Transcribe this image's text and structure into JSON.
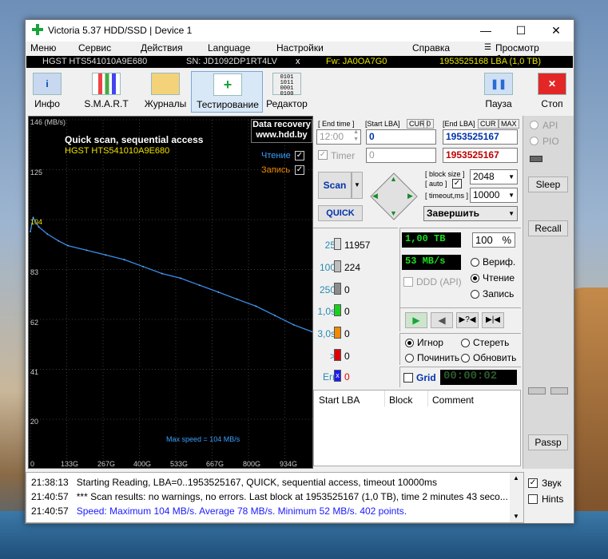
{
  "window": {
    "title": "Victoria 5.37 HDD/SSD | Device 1",
    "minimize": "—",
    "maximize": "☐",
    "close": "✕"
  },
  "menu": [
    "Меню",
    "Сервис",
    "Действия",
    "Language",
    "Настройки",
    "Справка"
  ],
  "menu_right": "Просмотр буфера",
  "info": {
    "model": "HGST HTS541010A9E680",
    "serial": "SN: JD1092DP1RT4LV",
    "x": "x",
    "fw": "Fw: JA0OA7G0",
    "capacity": "1953525168 LBA (1,0 TB)"
  },
  "toolbar": {
    "info": "Инфо",
    "smart": "S.M.A.R.T",
    "logs": "Журналы",
    "test": "Тестирование",
    "editor": "Редактор",
    "pause": "Пауза",
    "stop": "Стоп"
  },
  "graph": {
    "ymax": "146 (MB/s)",
    "y125": "125",
    "y104": "104",
    "y83": "83",
    "y62": "62",
    "y41": "41",
    "y20": "20",
    "x0": "0",
    "x1": "133G",
    "x2": "267G",
    "x3": "400G",
    "x4": "533G",
    "x5": "667G",
    "x6": "800G",
    "x7": "934G",
    "caption1": "Quick scan, sequential access",
    "caption2": "HGST HTS541010A9E680",
    "recovery1": "Data recovery",
    "recovery2": "www.hdd.by",
    "read_label": "Чтение",
    "write_label": "Запись",
    "max_speed": "Max speed = 104 MB/s"
  },
  "controls": {
    "end_time_label": "[ End time ]",
    "start_lba_label": "[Start LBA]",
    "cur": "CUR",
    "zero": "0",
    "end_lba_label": "[End LBA]",
    "max": "MAX",
    "time_value": "12:00",
    "start_lba": "0",
    "end_lba": "1953525167",
    "end_lba2": "1953525167",
    "timer_label": "Timer",
    "timer_value": "0",
    "scan": "Scan",
    "quick": "QUICK",
    "block_size_label": "[ block size ]",
    "auto_label": "[ auto ]",
    "timeout_label": "[ timeout,ms ]",
    "block_size": "2048",
    "timeout": "10000",
    "finish": "Завершить"
  },
  "counters": [
    {
      "label": "25",
      "count": "11957",
      "color": "#dcdcdc"
    },
    {
      "label": "100",
      "count": "224",
      "color": "#bdbdbd"
    },
    {
      "label": "250",
      "count": "0",
      "color": "#8c8c8c"
    },
    {
      "label": "1,0s",
      "count": "0",
      "color": "#19d119"
    },
    {
      "label": "3,0s",
      "count": "0",
      "color": "#f08a00"
    },
    {
      "label": ">",
      "count": "0",
      "color": "#e00000"
    },
    {
      "label": "Err",
      "count": "0",
      "color": "#1a1aff"
    }
  ],
  "status": {
    "done": "1,00 TB",
    "percent": "100",
    "pct": "%",
    "speed": "53 MB/s",
    "verify": "Вериф.",
    "read": "Чтение",
    "write": "Запись",
    "ddd": "DDD (API)",
    "ignore": "Игнор",
    "erase": "Стереть",
    "repair": "Починить",
    "refresh": "Обновить",
    "grid": "Grid",
    "timer": "00:00:02"
  },
  "table": {
    "col1": "Start LBA",
    "col2": "Block",
    "col3": "Comment"
  },
  "side": {
    "api": "API",
    "pio": "PIO",
    "sleep": "Sleep",
    "recall": "Recall",
    "passp": "Passp"
  },
  "log": [
    {
      "time": "21:38:13",
      "text": "Starting Reading, LBA=0..1953525167, QUICK, sequential access, timeout 10000ms",
      "color": "#000"
    },
    {
      "time": "21:40:57",
      "text": "*** Scan results: no warnings, no errors. Last block at 1953525167 (1,0 TB), time 2 minutes 43 seco...",
      "color": "#000"
    },
    {
      "time": "21:40:57",
      "text": "Speed: Maximum 104 MB/s. Average 78 MB/s. Minimum 52 MB/s. 402 points.",
      "color": "#1a1aff"
    }
  ],
  "opts": {
    "sound": "Звук",
    "hints": "Hints"
  },
  "chart_data": {
    "type": "line",
    "xlabel": "",
    "ylabel": "",
    "ylim": [
      0,
      146
    ],
    "x_ticks": [
      "0",
      "133G",
      "267G",
      "400G",
      "533G",
      "667G",
      "800G",
      "934G"
    ],
    "y_ticks": [
      "146 (MB/s)",
      "125",
      "104",
      "83",
      "62",
      "41",
      "20"
    ],
    "series": [
      {
        "name": "Чтение",
        "x": [
          0,
          10,
          30,
          60,
          100,
          133,
          200,
          267,
          333,
          400,
          467,
          533,
          600,
          667,
          733,
          800,
          867,
          934,
          1000
        ],
        "values": [
          98,
          104,
          100,
          97,
          94,
          92,
          90,
          88,
          86,
          83,
          80,
          78,
          75,
          72,
          69,
          66,
          62,
          58,
          55
        ]
      }
    ]
  }
}
